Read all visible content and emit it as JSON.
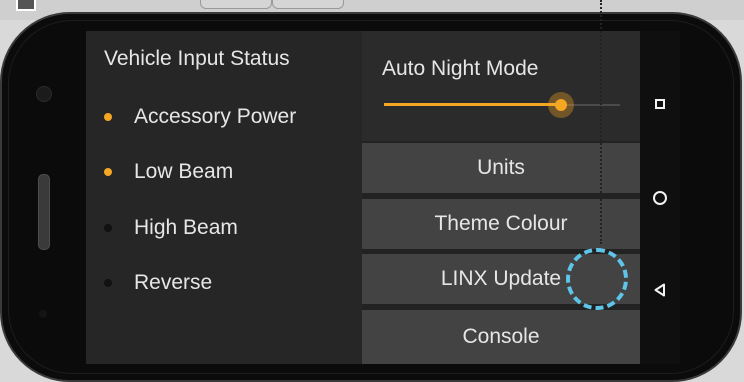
{
  "vehicle_input": {
    "title": "Vehicle Input Status",
    "items": [
      {
        "label": "Accessory Power",
        "active": true
      },
      {
        "label": "Low Beam",
        "active": true
      },
      {
        "label": "High Beam",
        "active": false
      },
      {
        "label": "Reverse",
        "active": false
      }
    ]
  },
  "night_mode": {
    "title": "Auto Night Mode",
    "slider_value_fraction": 0.75
  },
  "menu": {
    "items": [
      "Units",
      "Theme Colour",
      "LINX Update",
      "Console"
    ]
  },
  "nav": {
    "icons": [
      "recents-square-icon",
      "home-circle-icon",
      "back-triangle-icon"
    ]
  },
  "colors": {
    "accent": "#f5a623",
    "inactive_dot": "#111111",
    "tap_ring": "#5ec4e8"
  }
}
